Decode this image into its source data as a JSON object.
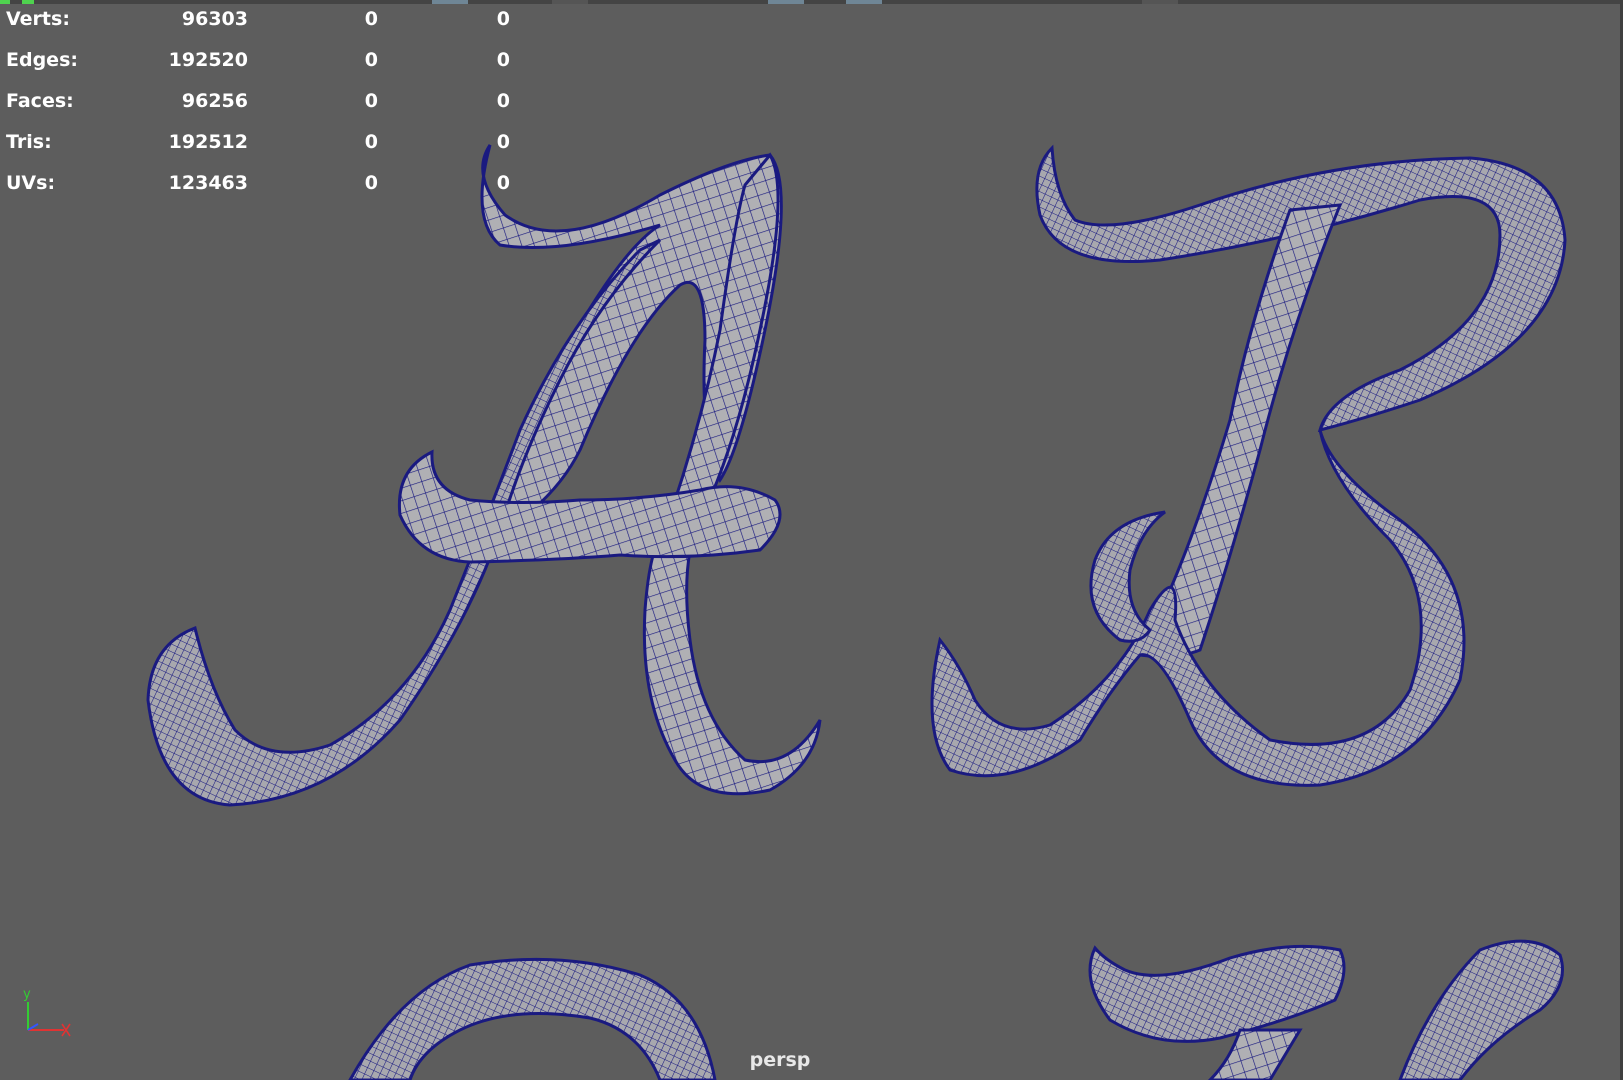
{
  "hud": {
    "rows": [
      {
        "label": "Verts:",
        "total": "96303",
        "selected": "0",
        "component": "0"
      },
      {
        "label": "Edges:",
        "total": "192520",
        "selected": "0",
        "component": "0"
      },
      {
        "label": "Faces:",
        "total": "96256",
        "selected": "0",
        "component": "0"
      },
      {
        "label": "Tris:",
        "total": "192512",
        "selected": "0",
        "component": "0"
      },
      {
        "label": "UVs:",
        "total": "123463",
        "selected": "0",
        "component": "0"
      }
    ]
  },
  "viewport": {
    "camera": "persp",
    "background_color": "#5d5d5d",
    "mesh_fill_color": "#b0b0b4",
    "wireframe_color": "#1a1a80",
    "objects": [
      "letter-a-mesh",
      "letter-b-mesh",
      "letter-c-mesh",
      "letter-d-mesh"
    ]
  },
  "axis_gizmo": {
    "y_label": "y",
    "y_color": "#33cc33",
    "x_color": "#e03333",
    "z_color": "#3355ff"
  }
}
